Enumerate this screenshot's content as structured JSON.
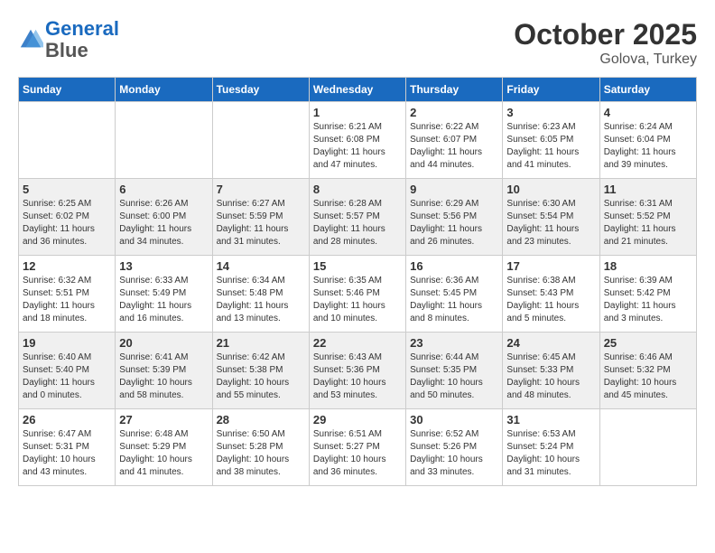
{
  "header": {
    "logo_line1": "General",
    "logo_line2": "Blue",
    "month_title": "October 2025",
    "subtitle": "Golova, Turkey"
  },
  "weekdays": [
    "Sunday",
    "Monday",
    "Tuesday",
    "Wednesday",
    "Thursday",
    "Friday",
    "Saturday"
  ],
  "weeks": [
    [
      {
        "day": "",
        "info": ""
      },
      {
        "day": "",
        "info": ""
      },
      {
        "day": "",
        "info": ""
      },
      {
        "day": "1",
        "info": "Sunrise: 6:21 AM\nSunset: 6:08 PM\nDaylight: 11 hours\nand 47 minutes."
      },
      {
        "day": "2",
        "info": "Sunrise: 6:22 AM\nSunset: 6:07 PM\nDaylight: 11 hours\nand 44 minutes."
      },
      {
        "day": "3",
        "info": "Sunrise: 6:23 AM\nSunset: 6:05 PM\nDaylight: 11 hours\nand 41 minutes."
      },
      {
        "day": "4",
        "info": "Sunrise: 6:24 AM\nSunset: 6:04 PM\nDaylight: 11 hours\nand 39 minutes."
      }
    ],
    [
      {
        "day": "5",
        "info": "Sunrise: 6:25 AM\nSunset: 6:02 PM\nDaylight: 11 hours\nand 36 minutes."
      },
      {
        "day": "6",
        "info": "Sunrise: 6:26 AM\nSunset: 6:00 PM\nDaylight: 11 hours\nand 34 minutes."
      },
      {
        "day": "7",
        "info": "Sunrise: 6:27 AM\nSunset: 5:59 PM\nDaylight: 11 hours\nand 31 minutes."
      },
      {
        "day": "8",
        "info": "Sunrise: 6:28 AM\nSunset: 5:57 PM\nDaylight: 11 hours\nand 28 minutes."
      },
      {
        "day": "9",
        "info": "Sunrise: 6:29 AM\nSunset: 5:56 PM\nDaylight: 11 hours\nand 26 minutes."
      },
      {
        "day": "10",
        "info": "Sunrise: 6:30 AM\nSunset: 5:54 PM\nDaylight: 11 hours\nand 23 minutes."
      },
      {
        "day": "11",
        "info": "Sunrise: 6:31 AM\nSunset: 5:52 PM\nDaylight: 11 hours\nand 21 minutes."
      }
    ],
    [
      {
        "day": "12",
        "info": "Sunrise: 6:32 AM\nSunset: 5:51 PM\nDaylight: 11 hours\nand 18 minutes."
      },
      {
        "day": "13",
        "info": "Sunrise: 6:33 AM\nSunset: 5:49 PM\nDaylight: 11 hours\nand 16 minutes."
      },
      {
        "day": "14",
        "info": "Sunrise: 6:34 AM\nSunset: 5:48 PM\nDaylight: 11 hours\nand 13 minutes."
      },
      {
        "day": "15",
        "info": "Sunrise: 6:35 AM\nSunset: 5:46 PM\nDaylight: 11 hours\nand 10 minutes."
      },
      {
        "day": "16",
        "info": "Sunrise: 6:36 AM\nSunset: 5:45 PM\nDaylight: 11 hours\nand 8 minutes."
      },
      {
        "day": "17",
        "info": "Sunrise: 6:38 AM\nSunset: 5:43 PM\nDaylight: 11 hours\nand 5 minutes."
      },
      {
        "day": "18",
        "info": "Sunrise: 6:39 AM\nSunset: 5:42 PM\nDaylight: 11 hours\nand 3 minutes."
      }
    ],
    [
      {
        "day": "19",
        "info": "Sunrise: 6:40 AM\nSunset: 5:40 PM\nDaylight: 11 hours\nand 0 minutes."
      },
      {
        "day": "20",
        "info": "Sunrise: 6:41 AM\nSunset: 5:39 PM\nDaylight: 10 hours\nand 58 minutes."
      },
      {
        "day": "21",
        "info": "Sunrise: 6:42 AM\nSunset: 5:38 PM\nDaylight: 10 hours\nand 55 minutes."
      },
      {
        "day": "22",
        "info": "Sunrise: 6:43 AM\nSunset: 5:36 PM\nDaylight: 10 hours\nand 53 minutes."
      },
      {
        "day": "23",
        "info": "Sunrise: 6:44 AM\nSunset: 5:35 PM\nDaylight: 10 hours\nand 50 minutes."
      },
      {
        "day": "24",
        "info": "Sunrise: 6:45 AM\nSunset: 5:33 PM\nDaylight: 10 hours\nand 48 minutes."
      },
      {
        "day": "25",
        "info": "Sunrise: 6:46 AM\nSunset: 5:32 PM\nDaylight: 10 hours\nand 45 minutes."
      }
    ],
    [
      {
        "day": "26",
        "info": "Sunrise: 6:47 AM\nSunset: 5:31 PM\nDaylight: 10 hours\nand 43 minutes."
      },
      {
        "day": "27",
        "info": "Sunrise: 6:48 AM\nSunset: 5:29 PM\nDaylight: 10 hours\nand 41 minutes."
      },
      {
        "day": "28",
        "info": "Sunrise: 6:50 AM\nSunset: 5:28 PM\nDaylight: 10 hours\nand 38 minutes."
      },
      {
        "day": "29",
        "info": "Sunrise: 6:51 AM\nSunset: 5:27 PM\nDaylight: 10 hours\nand 36 minutes."
      },
      {
        "day": "30",
        "info": "Sunrise: 6:52 AM\nSunset: 5:26 PM\nDaylight: 10 hours\nand 33 minutes."
      },
      {
        "day": "31",
        "info": "Sunrise: 6:53 AM\nSunset: 5:24 PM\nDaylight: 10 hours\nand 31 minutes."
      },
      {
        "day": "",
        "info": ""
      }
    ]
  ]
}
